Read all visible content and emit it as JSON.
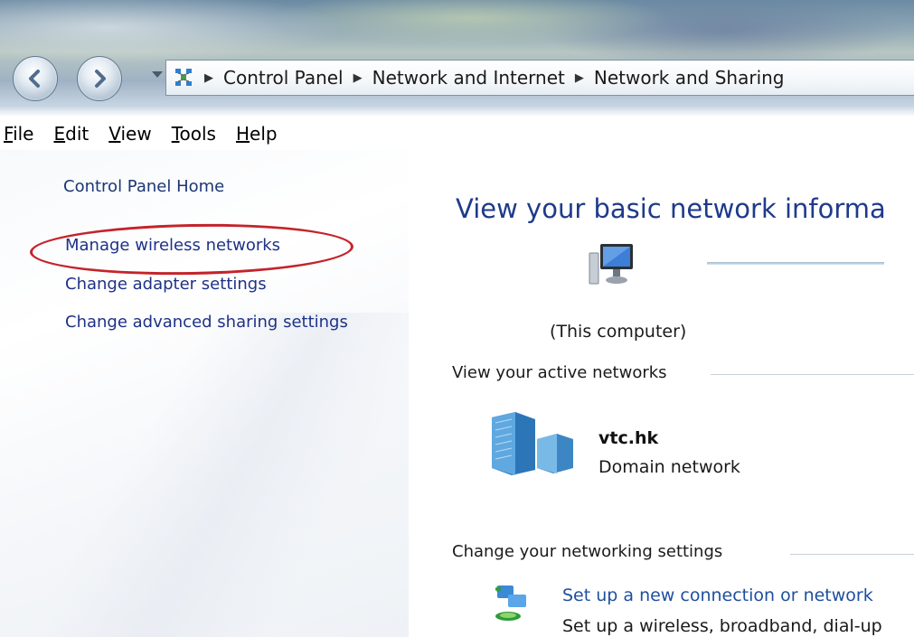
{
  "breadcrumb": [
    "Control Panel",
    "Network and Internet",
    "Network and Sharing"
  ],
  "menu": {
    "file": {
      "pre": "",
      "key": "F",
      "post": "ile"
    },
    "edit": {
      "pre": "",
      "key": "E",
      "post": "dit"
    },
    "view": {
      "pre": "",
      "key": "V",
      "post": "iew"
    },
    "tools": {
      "pre": "",
      "key": "T",
      "post": "ools"
    },
    "help": {
      "pre": "",
      "key": "H",
      "post": "elp"
    }
  },
  "sidebar": {
    "home": "Control Panel Home",
    "links": [
      "Manage wireless networks",
      "Change adapter settings",
      "Change advanced sharing settings"
    ]
  },
  "main": {
    "title": "View your basic network informa",
    "this_computer": "(This computer)",
    "active_section": "View your active networks",
    "active_network": {
      "name": "vtc.hk",
      "type": "Domain network"
    },
    "change_section": "Change your networking settings",
    "tasks": [
      {
        "label": "Set up a new connection or network",
        "description": "Set up a wireless, broadband, dial-up"
      }
    ]
  },
  "colors": {
    "link": "#1e3287",
    "title": "#1e3a8a",
    "highlight": "#c4232b"
  },
  "icons": [
    "back-icon",
    "forward-icon",
    "network-center-icon",
    "computer-icon",
    "domain-network-icon",
    "new-connection-icon"
  ]
}
